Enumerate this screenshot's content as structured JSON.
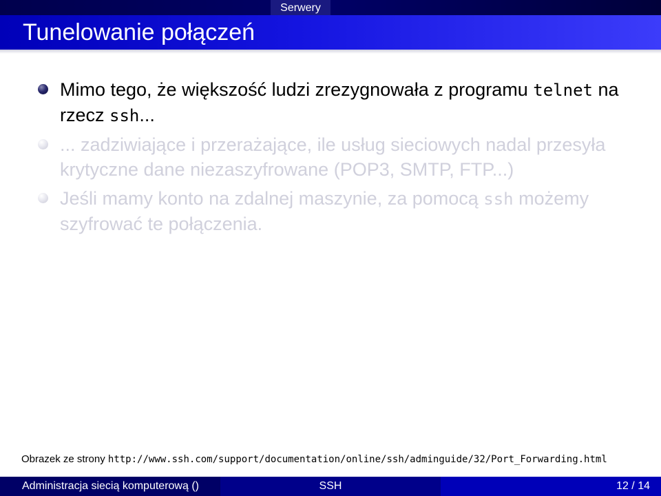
{
  "header": {
    "section": "Serwery",
    "title": "Tunelowanie połączeń"
  },
  "bullets": [
    {
      "state": "active",
      "text_before": "Mimo tego, że większość ludzi zrezygnowała z programu ",
      "code_1": "telnet",
      "text_middle": " na rzecz ",
      "code_2": "ssh",
      "text_after": "..."
    },
    {
      "state": "inactive",
      "text": "... zadziwiające i przerażające, ile usług sieciowych nadal przesyła krytyczne dane niezaszyfrowane (POP3, SMTP, FTP...)"
    },
    {
      "state": "inactive",
      "text_before": "Jeśli mamy konto na zdalnej maszynie, za pomocą ",
      "code": "ssh",
      "text_after": " możemy szyfrować te połączenia."
    }
  ],
  "source": {
    "label": "Obrazek ze strony",
    "url": "http://www.ssh.com/support/documentation/online/ssh/adminguide/32/Port_Forwarding.html"
  },
  "footer": {
    "course": "Administracja siecią komputerową  ()",
    "topic": "SSH",
    "page": "12 / 14"
  },
  "colors": {
    "title_bar": "#1414e0",
    "nav_strip": "#000066",
    "footer_left": "#000066",
    "footer_mid": "#00008a",
    "footer_right": "#0000b8",
    "dimmed_text": "#d0d0dc"
  }
}
